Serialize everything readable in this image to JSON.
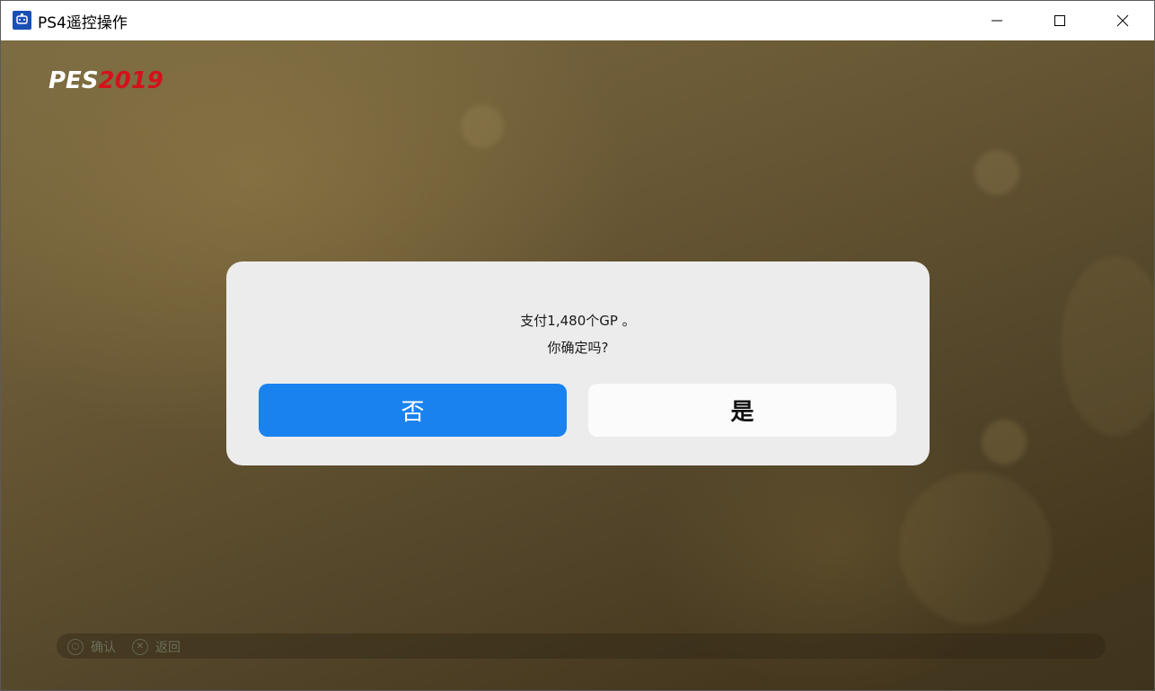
{
  "window": {
    "title": "PS4遥控操作",
    "icon": "ps4-remote-play-icon",
    "controls": [
      "minimize-icon",
      "maximize-icon",
      "close-icon"
    ]
  },
  "game": {
    "logo_pes": "PES",
    "logo_year": "2019",
    "logo_year_color": "#d4111b"
  },
  "dialog": {
    "message_line1": "支付1,480个GP 。",
    "message_line2": "你确定吗?",
    "no_label": "否",
    "yes_label": "是",
    "no_color": "#1a82ef",
    "yes_color": "#fbfbfb"
  },
  "footer": {
    "confirm_glyph": "○",
    "confirm_label": "确认",
    "back_glyph": "✕",
    "back_label": "返回"
  }
}
